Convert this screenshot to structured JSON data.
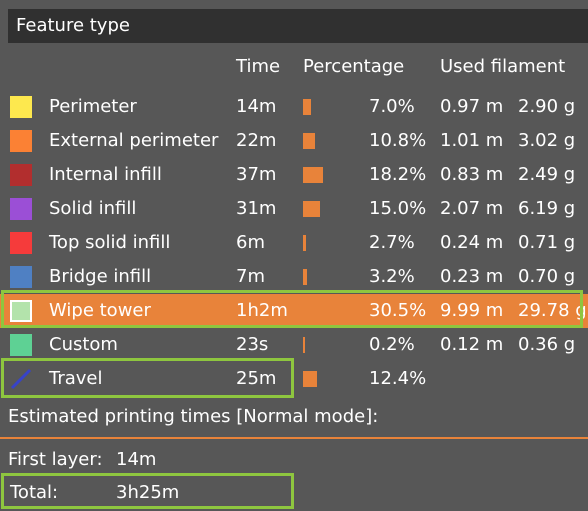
{
  "legend": {
    "title": "Feature type",
    "headers": {
      "time": "Time",
      "percentage": "Percentage",
      "used_filament": "Used filament"
    },
    "rows": [
      {
        "name": "Perimeter",
        "time": "14m",
        "percentage": "7.0%",
        "pct_value": 7.0,
        "length": "0.97 m",
        "weight": "2.90 g",
        "color": "#fde84e",
        "icon": "color-swatch"
      },
      {
        "name": "External perimeter",
        "time": "22m",
        "percentage": "10.8%",
        "pct_value": 10.8,
        "length": "1.01 m",
        "weight": "3.02 g",
        "color": "#fb8134",
        "icon": "color-swatch"
      },
      {
        "name": "Internal infill",
        "time": "37m",
        "percentage": "18.2%",
        "pct_value": 18.2,
        "length": "0.83 m",
        "weight": "2.49 g",
        "color": "#b22e2e",
        "icon": "color-swatch"
      },
      {
        "name": "Solid infill",
        "time": "31m",
        "percentage": "15.0%",
        "pct_value": 15.0,
        "length": "2.07 m",
        "weight": "6.19 g",
        "color": "#9b4fd6",
        "icon": "color-swatch"
      },
      {
        "name": "Top solid infill",
        "time": "6m",
        "percentage": "2.7%",
        "pct_value": 2.7,
        "length": "0.24 m",
        "weight": "0.71 g",
        "color": "#f53b3b",
        "icon": "color-swatch"
      },
      {
        "name": "Bridge infill",
        "time": "7m",
        "percentage": "3.2%",
        "pct_value": 3.2,
        "length": "0.23 m",
        "weight": "0.70 g",
        "color": "#4f80c3",
        "icon": "color-swatch"
      },
      {
        "name": "Wipe tower",
        "time": "1h2m",
        "percentage": "30.5%",
        "pct_value": 30.5,
        "length": "9.99 m",
        "weight": "29.78 g",
        "color": "#b3e3ab",
        "icon": "color-swatch",
        "highlighted": true
      },
      {
        "name": "Custom",
        "time": "23s",
        "percentage": "0.2%",
        "pct_value": 0.2,
        "length": "0.12 m",
        "weight": "0.36 g",
        "color": "#5ed194",
        "icon": "color-swatch"
      },
      {
        "name": "Travel",
        "time": "25m",
        "percentage": "12.4%",
        "pct_value": 12.4,
        "length": "",
        "weight": "",
        "color": "#3743c8",
        "icon": "travel-line-icon"
      }
    ]
  },
  "estimates": {
    "heading": "Estimated printing times [Normal mode]:",
    "first_layer_label": "First layer:",
    "first_layer_value": "14m",
    "total_label": "Total:",
    "total_value": "3h25m"
  },
  "colors": {
    "accent": "#e8833a",
    "highlight_box": "#8ec63f",
    "background": "#575757",
    "title_bg": "#303030"
  }
}
